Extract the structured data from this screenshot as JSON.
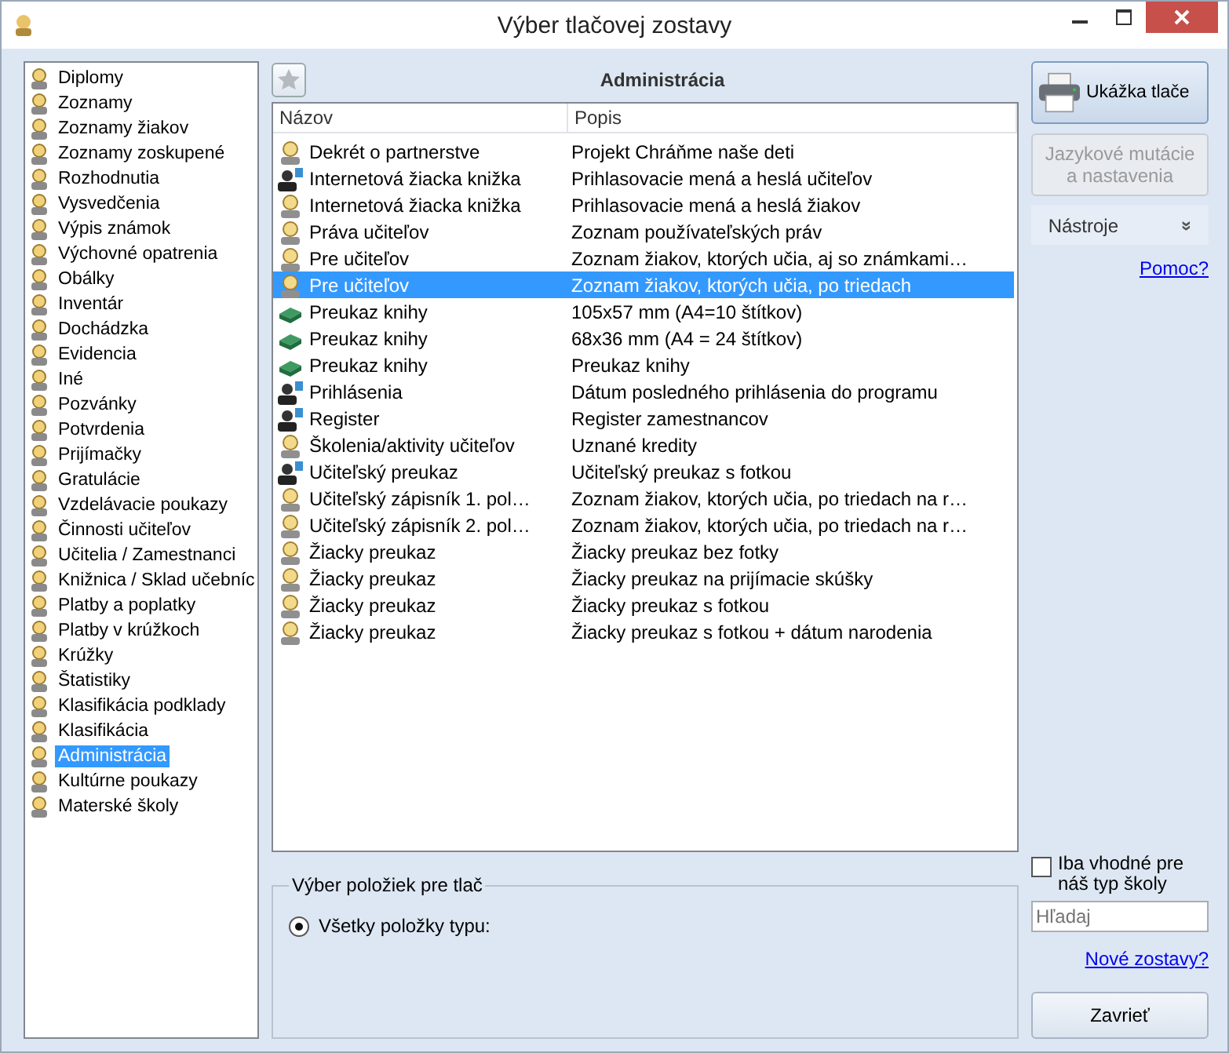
{
  "window": {
    "title": "Výber tlačovej zostavy"
  },
  "sidebar": {
    "items": [
      {
        "label": "Diplomy",
        "selected": false
      },
      {
        "label": "Zoznamy",
        "selected": false
      },
      {
        "label": "Zoznamy žiakov",
        "selected": false
      },
      {
        "label": "Zoznamy zoskupené",
        "selected": false
      },
      {
        "label": "Rozhodnutia",
        "selected": false
      },
      {
        "label": "Vysvedčenia",
        "selected": false
      },
      {
        "label": "Výpis známok",
        "selected": false
      },
      {
        "label": "Výchovné opatrenia",
        "selected": false
      },
      {
        "label": "Obálky",
        "selected": false
      },
      {
        "label": "Inventár",
        "selected": false
      },
      {
        "label": "Dochádzka",
        "selected": false
      },
      {
        "label": "Evidencia",
        "selected": false
      },
      {
        "label": "Iné",
        "selected": false
      },
      {
        "label": "Pozvánky",
        "selected": false
      },
      {
        "label": "Potvrdenia",
        "selected": false
      },
      {
        "label": "Prijímačky",
        "selected": false
      },
      {
        "label": "Gratulácie",
        "selected": false
      },
      {
        "label": "Vzdelávacie poukazy",
        "selected": false
      },
      {
        "label": "Činnosti učiteľov",
        "selected": false
      },
      {
        "label": "Učitelia / Zamestnanci",
        "selected": false
      },
      {
        "label": "Knižnica / Sklad učebníc",
        "selected": false
      },
      {
        "label": "Platby a poplatky",
        "selected": false
      },
      {
        "label": "Platby v krúžkoch",
        "selected": false
      },
      {
        "label": "Krúžky",
        "selected": false
      },
      {
        "label": "Štatistiky",
        "selected": false
      },
      {
        "label": "Klasifikácia podklady",
        "selected": false
      },
      {
        "label": "Klasifikácia",
        "selected": false
      },
      {
        "label": "Administrácia",
        "selected": true
      },
      {
        "label": "Kultúrne poukazy",
        "selected": false
      },
      {
        "label": "Materské školy",
        "selected": false
      }
    ]
  },
  "list": {
    "title": "Administrácia",
    "columns": [
      "Názov",
      "Popis"
    ],
    "rows": [
      {
        "kind": "student",
        "name": "Dekrét o partnerstve",
        "description": "Projekt Chráňme naše deti",
        "selected": false
      },
      {
        "kind": "teacher",
        "name": "Internetová žiacka knižka",
        "description": "Prihlasovacie mená a heslá učiteľov",
        "selected": false
      },
      {
        "kind": "student",
        "name": "Internetová žiacka knižka",
        "description": "Prihlasovacie mená a heslá žiakov",
        "selected": false
      },
      {
        "kind": "student",
        "name": "Práva učiteľov",
        "description": "Zoznam používateľských práv",
        "selected": false
      },
      {
        "kind": "student",
        "name": "Pre učiteľov",
        "description": "Zoznam žiakov, ktorých učia, aj so známkami…",
        "selected": false
      },
      {
        "kind": "student",
        "name": "Pre učiteľov",
        "description": "Zoznam žiakov, ktorých učia, po triedach",
        "selected": true
      },
      {
        "kind": "book",
        "name": "Preukaz knihy",
        "description": "105x57 mm (A4=10 štítkov)",
        "selected": false
      },
      {
        "kind": "book",
        "name": "Preukaz knihy",
        "description": "68x36 mm (A4 = 24 štítkov)",
        "selected": false
      },
      {
        "kind": "book",
        "name": "Preukaz knihy",
        "description": "Preukaz knihy",
        "selected": false
      },
      {
        "kind": "teacher",
        "name": "Prihlásenia",
        "description": "Dátum posledného prihlásenia do programu",
        "selected": false
      },
      {
        "kind": "teacher",
        "name": "Register",
        "description": "Register zamestnancov",
        "selected": false
      },
      {
        "kind": "student",
        "name": "Školenia/aktivity učiteľov",
        "description": "Uznané kredity",
        "selected": false
      },
      {
        "kind": "teacher",
        "name": "Učiteľský preukaz",
        "description": "Učiteľský preukaz s fotkou",
        "selected": false
      },
      {
        "kind": "student",
        "name": "Učiteľský zápisník 1. pol…",
        "description": "Zoznam žiakov, ktorých učia, po triedach na r…",
        "selected": false
      },
      {
        "kind": "student",
        "name": "Učiteľský zápisník 2. pol…",
        "description": "Zoznam žiakov, ktorých učia, po triedach na r…",
        "selected": false
      },
      {
        "kind": "student",
        "name": "Žiacky preukaz",
        "description": "Žiacky preukaz bez fotky",
        "selected": false
      },
      {
        "kind": "student",
        "name": "Žiacky preukaz",
        "description": "Žiacky preukaz na prijímacie skúšky",
        "selected": false
      },
      {
        "kind": "student",
        "name": "Žiacky preukaz",
        "description": "Žiacky preukaz s fotkou",
        "selected": false
      },
      {
        "kind": "student",
        "name": "Žiacky preukaz",
        "description": "Žiacky preukaz s fotkou + dátum narodenia",
        "selected": false
      }
    ]
  },
  "print_selection": {
    "legend": "Výber položiek pre tlač",
    "options": [
      {
        "label": "Všetky položky typu:",
        "selected": true
      }
    ]
  },
  "actions": {
    "preview_button": "Ukážka tlače",
    "language_button": {
      "label": "Jazykové mutácie a nastavenia",
      "disabled": true
    },
    "tools": {
      "label": "Nástroje",
      "expand_glyph": "»"
    },
    "help_link": "Pomoc?"
  },
  "filter": {
    "checkbox": {
      "label": "Iba vhodné pre náš typ školy",
      "checked": false
    },
    "search": {
      "placeholder": "Hľadaj"
    },
    "new_reports_link": "Nové zostavy?",
    "close_button": "Zavrieť"
  }
}
